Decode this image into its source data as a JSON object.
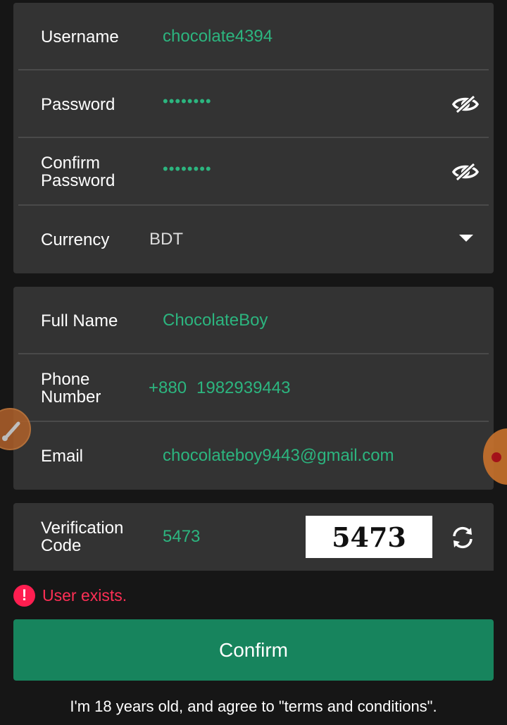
{
  "account": {
    "username_label": "Username",
    "username_value": "chocolate4394",
    "password_label": "Password",
    "password_value": "••••••••",
    "confirm_label_1": "Confirm",
    "confirm_label_2": "Password",
    "confirm_value": "••••••••",
    "currency_label": "Currency",
    "currency_value": "BDT"
  },
  "profile": {
    "fullname_label": "Full Name",
    "fullname_value": "ChocolateBoy",
    "phone_label_1": "Phone",
    "phone_label_2": "Number",
    "phone_code": "+880",
    "phone_value": "1982939443",
    "email_label": "Email",
    "email_value": "chocolateboy9443@gmail.com"
  },
  "verification": {
    "label_1": "Verification",
    "label_2": "Code",
    "value": "5473",
    "captcha_text": "5473"
  },
  "error": {
    "icon": "!",
    "message": "User exists."
  },
  "confirm_label": "Confirm",
  "terms_text": "I'm 18 years old, and agree to \"terms and conditions\".",
  "colors": {
    "accent": "#2cb57f",
    "button": "#17845d",
    "error": "#ff1e50",
    "card": "#333333",
    "background": "#161616"
  },
  "icons": [
    "eye-off-icon",
    "chevron-down-icon",
    "refresh-icon",
    "error-icon",
    "brush-icon"
  ]
}
